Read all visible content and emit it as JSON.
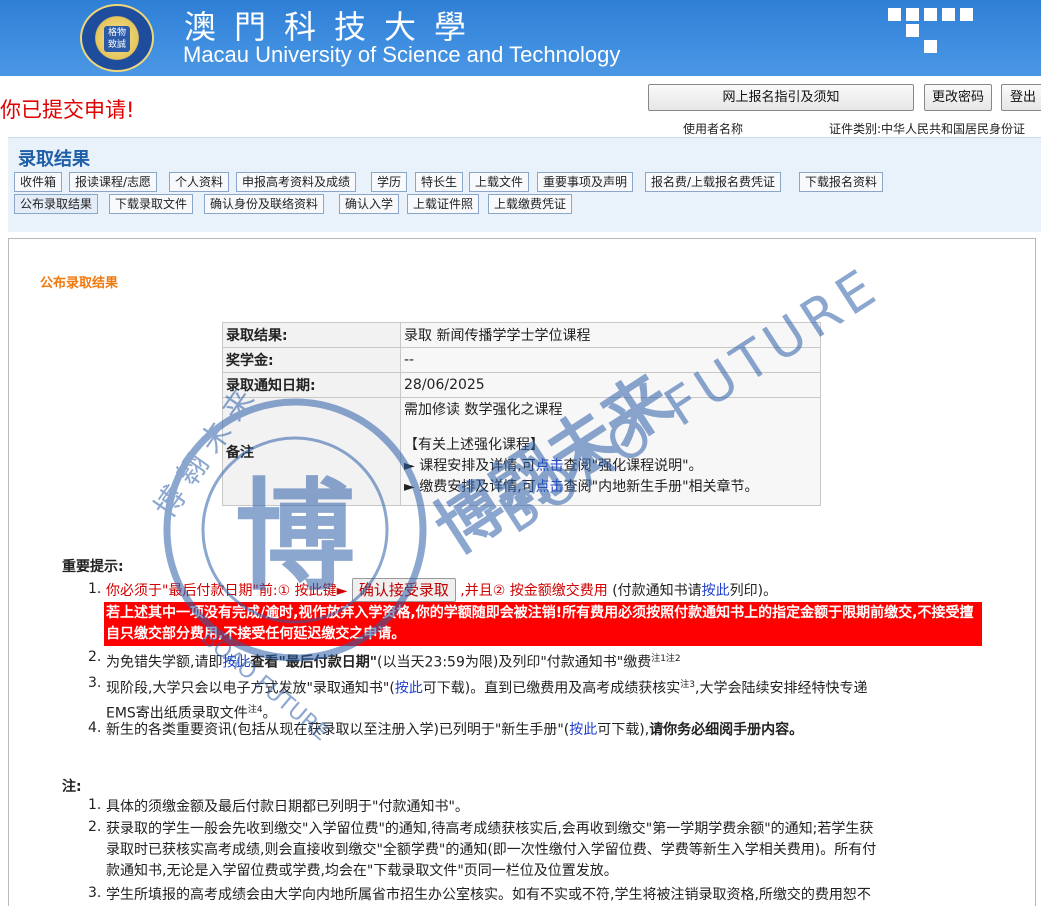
{
  "header": {
    "university_cn": "澳門科技大學",
    "university_en": "Macau University of Science and Technology",
    "logo_text": "格物致誠"
  },
  "status": {
    "submitted_message": "你已提交申请!",
    "guide_button": "网上报名指引及须知",
    "change_password_button": "更改密码",
    "logout_button": "登出",
    "user_label": "使用者名称",
    "id_type_label": "证件类别:中华人民共和国居民身份证"
  },
  "nav": {
    "section_title": "录取结果",
    "row1": [
      "收件箱",
      "报读课程/志愿",
      "个人资料",
      "申报高考资料及成绩",
      "学历",
      "特长生",
      "上载文件",
      "重要事项及声明",
      "报名费/上载报名费凭证",
      "下载报名资料"
    ],
    "row2": [
      "公布录取结果",
      "下载录取文件",
      "确认身份及联络资料",
      "确认入学",
      "上载证件照",
      "上载缴费凭证"
    ]
  },
  "content": {
    "heading": "公布录取结果",
    "result": {
      "result_label": "录取结果:",
      "result_value": "录取 新闻传播学学士学位课程",
      "scholarship_label": "奖学金:",
      "scholarship_value": "--",
      "notice_date_label": "录取通知日期:",
      "notice_date_value": "28/06/2025",
      "remark_label": "备注",
      "remark_line1": "需加修读 数学强化之课程",
      "remark_line2": "【有关上述强化课程】",
      "remark_line3_pre": "► 课程安排及详情,可",
      "remark_line3_link": "点击",
      "remark_line3_post": "查阅\"强化课程说明\"。",
      "remark_line4_pre": "► 缴费安排及详情,可",
      "remark_line4_link": "点击",
      "remark_line4_post": "查阅\"内地新生手册\"相关章节。"
    },
    "important_title": "重要提示:",
    "important": {
      "i1_num": "1.",
      "i1_part1": "你必须于\"最后付款日期\"前:① 按此键►",
      "i1_button": "确认接受录取",
      "i1_part2": ",并且② 按金额缴交费用",
      "i1_part3": "(付款通知书请",
      "i1_link": "按此",
      "i1_part4": "列印)。",
      "red_box": "若上述其中一项没有完成/逾时,视作放弃入学资格,你的学额随即会被注销!所有费用必须按照付款通知书上的指定金额于限期前缴交,不接受擅自只缴交部分费用,不接受任何延迟缴交之申请。",
      "i2_num": "2.",
      "i2_pre": "为免错失学额,请即",
      "i2_link": "按此",
      "i2_mid": "查看\"最后付款日期\"",
      "i2_post": "(以当天23:59为限)及列印\"付款通知书\"缴费",
      "i2_sup": "注1注2",
      "i3_num": "3.",
      "i3_pre": "现阶段,大学只会以电子方式发放\"录取通知书\"(",
      "i3_link": "按此",
      "i3_mid": "可下载)。直到已缴费用及高考成绩获核实",
      "i3_sup": "注3",
      "i3_post": ",大学会陆续安排经特快专递",
      "i3_line2": "EMS寄出纸质录取文件",
      "i3_sup2": "注4",
      "i3_end": "。",
      "i4_num": "4.",
      "i4_pre": "新生的各类重要资讯(包括从现在获录取以至注册入学)已列明于\"新生手册\"(",
      "i4_link": "按此",
      "i4_mid": "可下载),",
      "i4_bold": "请你务必细阅手册内容。"
    },
    "notes_title": "注:",
    "notes": {
      "n1_num": "1.",
      "n1": "具体的须缴金额及最后付款日期都已列明于\"付款通知书\"。",
      "n2_num": "2.",
      "n2_line1": "获录取的学生一般会先收到缴交\"入学留位费\"的通知,待高考成绩获核实后,会再收到缴交\"第一学期学费余额\"的通知;若学生获",
      "n2_line2": "录取时已获核实高考成绩,则会直接收到缴交\"全额学费\"的通知(即一次性缴付入学留位费、学费等新生入学相关费用)。所有付",
      "n2_line3": "款通知书,无论是入学留位费或学费,均会在\"下载录取文件\"页同一栏位及位置发放。",
      "n3_num": "3.",
      "n3": "学生所填报的高考成绩会由大学向内地所属省市招生办公室核实。如有不实或不符,学生将被注销录取资格,所缴交的费用恕不"
    }
  },
  "watermark": {
    "cn": "博翱未来",
    "en": "BOAO FUTURE",
    "seal_char": "博",
    "seal_ring": "博 翱 未 来",
    "seal_en": "BOAO FUTURE",
    "color": "#2d5fa8"
  }
}
